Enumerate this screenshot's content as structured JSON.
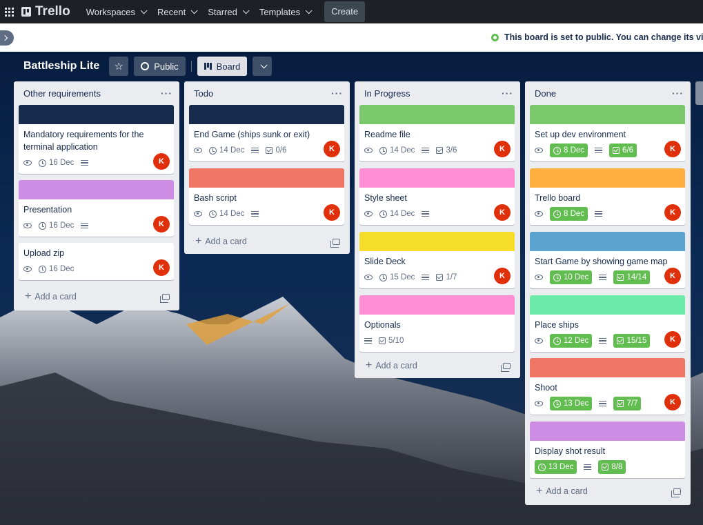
{
  "topbar": {
    "brand": "Trello",
    "nav": [
      "Workspaces",
      "Recent",
      "Starred",
      "Templates"
    ],
    "create_label": "Create"
  },
  "banner": {
    "message": "This board is set to public. You can change its visibilit"
  },
  "board": {
    "title": "Battleship Lite",
    "visibility_label": "Public",
    "view_label": "Board"
  },
  "add_card_label": "Add a card",
  "avatar_initial": "K",
  "colors": {
    "navy": "#172b4d",
    "green": "#7bc86c",
    "pink": "#ff8ed4",
    "purple": "#cd8de5",
    "red": "#ef7564",
    "yellow": "#f5dd29",
    "orange": "#ffaf3f",
    "blue": "#5ba4cf",
    "mint": "#6deca9"
  },
  "lists": [
    {
      "title": "Other requirements",
      "cards": [
        {
          "title": "Mandatory requirements for the terminal application",
          "cover": "#172b4d",
          "watch": true,
          "due": "16 Dec",
          "due_complete": false,
          "desc": true,
          "checklist": "",
          "avatar": true
        },
        {
          "title": "Presentation",
          "cover": "#cd8de5",
          "watch": true,
          "due": "16 Dec",
          "due_complete": false,
          "desc": true,
          "checklist": "",
          "avatar": true
        },
        {
          "title": "Upload zip",
          "cover": "",
          "watch": true,
          "due": "16 Dec",
          "due_complete": false,
          "desc": false,
          "checklist": "",
          "avatar": true
        }
      ]
    },
    {
      "title": "Todo",
      "cards": [
        {
          "title": "End Game (ships sunk or exit)",
          "cover": "#172b4d",
          "watch": true,
          "due": "14 Dec",
          "due_complete": false,
          "desc": true,
          "checklist": "0/6",
          "avatar": true
        },
        {
          "title": "Bash script",
          "cover": "#ef7564",
          "watch": true,
          "due": "14 Dec",
          "due_complete": false,
          "desc": true,
          "checklist": "",
          "avatar": true
        }
      ]
    },
    {
      "title": "In Progress",
      "cards": [
        {
          "title": "Readme file",
          "cover": "#7bc86c",
          "watch": true,
          "due": "14 Dec",
          "due_complete": false,
          "desc": true,
          "checklist": "3/6",
          "avatar": true
        },
        {
          "title": "Style sheet",
          "cover": "#ff8ed4",
          "watch": true,
          "due": "14 Dec",
          "due_complete": false,
          "desc": true,
          "checklist": "",
          "avatar": true
        },
        {
          "title": "Slide Deck",
          "cover": "#f5dd29",
          "watch": true,
          "due": "15 Dec",
          "due_complete": false,
          "desc": true,
          "checklist": "1/7",
          "avatar": true
        },
        {
          "title": "Optionals",
          "cover": "#ff8ed4",
          "watch": false,
          "due": "",
          "due_complete": false,
          "desc": true,
          "checklist": "5/10",
          "avatar": false
        }
      ]
    },
    {
      "title": "Done",
      "cards": [
        {
          "title": "Set up dev environment",
          "cover": "#7bc86c",
          "watch": true,
          "due": "8 Dec",
          "due_complete": true,
          "desc": true,
          "checklist": "6/6",
          "avatar": true
        },
        {
          "title": "Trello board",
          "cover": "#ffaf3f",
          "watch": true,
          "due": "8 Dec",
          "due_complete": true,
          "desc": true,
          "checklist": "",
          "avatar": true
        },
        {
          "title": "Start Game by showing game map",
          "cover": "#5ba4cf",
          "watch": true,
          "due": "10 Dec",
          "due_complete": true,
          "desc": true,
          "checklist": "14/14",
          "avatar": true
        },
        {
          "title": "Place ships",
          "cover": "#6deca9",
          "watch": true,
          "due": "12 Dec",
          "due_complete": true,
          "desc": true,
          "checklist": "15/15",
          "avatar": true
        },
        {
          "title": "Shoot",
          "cover": "#ef7564",
          "watch": true,
          "due": "13 Dec",
          "due_complete": true,
          "desc": true,
          "checklist": "7/7",
          "avatar": true
        },
        {
          "title": "Display shot result",
          "cover": "#cd8de5",
          "watch": false,
          "due": "13 Dec",
          "due_complete": true,
          "desc": true,
          "checklist": "8/8",
          "avatar": false
        }
      ]
    }
  ]
}
